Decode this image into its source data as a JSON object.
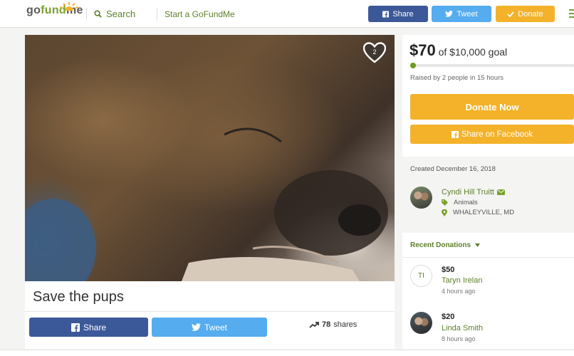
{
  "header": {
    "logo": {
      "go": "go",
      "fund": "fund",
      "me": "me"
    },
    "search_label": "Search",
    "start_label": "Start a GoFundMe",
    "share_label": "Share",
    "tweet_label": "Tweet",
    "donate_label": "Donate"
  },
  "campaign": {
    "title": "Save the pups",
    "heart_count": "2",
    "share_button": "Share",
    "tweet_button": "Tweet",
    "shares_count": "78",
    "shares_label": "shares"
  },
  "funding": {
    "amount": "$70",
    "goal_text": "of $10,000 goal",
    "progress_fraction": 0.007,
    "raised_by": "Raised by 2 people in 15 hours",
    "donate_now": "Donate Now",
    "share_facebook": "Share on Facebook"
  },
  "details": {
    "created": "Created December 16, 2018",
    "organizer": "Cyndi Hill Truitt",
    "category": "Animals",
    "location": "WHALEYVILLE, MD"
  },
  "recent": {
    "heading": "Recent Donations",
    "donations": [
      {
        "initials": "TI",
        "amount": "$50",
        "name": "Taryn Irelan",
        "time": "4 hours ago"
      },
      {
        "amount": "$20",
        "name": "Linda Smith",
        "time": "8 hours ago"
      }
    ]
  },
  "colors": {
    "brand_green": "#78a22f",
    "facebook": "#3b5998",
    "twitter": "#55acee",
    "donate": "#f3b229"
  },
  "icons": [
    "search-icon",
    "facebook-icon",
    "twitter-icon",
    "heart-icon",
    "trend-icon",
    "mail-icon",
    "tag-icon",
    "map-pin-icon",
    "chevron-down-icon",
    "menu-icon"
  ]
}
